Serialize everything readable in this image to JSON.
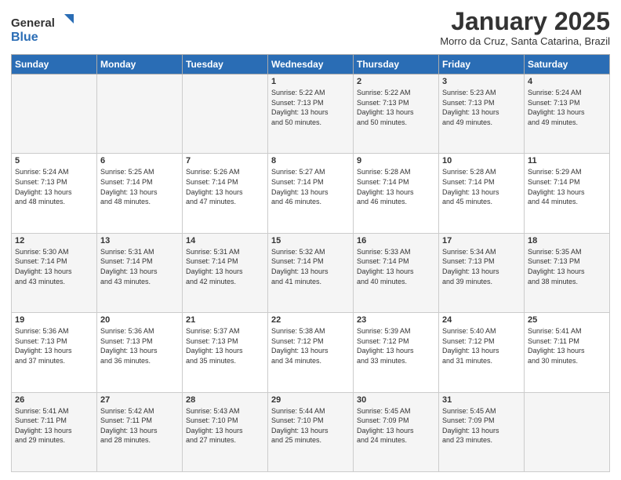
{
  "logo": {
    "line1": "General",
    "line2": "Blue"
  },
  "title": "January 2025",
  "location": "Morro da Cruz, Santa Catarina, Brazil",
  "days_header": [
    "Sunday",
    "Monday",
    "Tuesday",
    "Wednesday",
    "Thursday",
    "Friday",
    "Saturday"
  ],
  "weeks": [
    [
      {
        "day": "",
        "info": ""
      },
      {
        "day": "",
        "info": ""
      },
      {
        "day": "",
        "info": ""
      },
      {
        "day": "1",
        "info": "Sunrise: 5:22 AM\nSunset: 7:13 PM\nDaylight: 13 hours\nand 50 minutes."
      },
      {
        "day": "2",
        "info": "Sunrise: 5:22 AM\nSunset: 7:13 PM\nDaylight: 13 hours\nand 50 minutes."
      },
      {
        "day": "3",
        "info": "Sunrise: 5:23 AM\nSunset: 7:13 PM\nDaylight: 13 hours\nand 49 minutes."
      },
      {
        "day": "4",
        "info": "Sunrise: 5:24 AM\nSunset: 7:13 PM\nDaylight: 13 hours\nand 49 minutes."
      }
    ],
    [
      {
        "day": "5",
        "info": "Sunrise: 5:24 AM\nSunset: 7:13 PM\nDaylight: 13 hours\nand 48 minutes."
      },
      {
        "day": "6",
        "info": "Sunrise: 5:25 AM\nSunset: 7:14 PM\nDaylight: 13 hours\nand 48 minutes."
      },
      {
        "day": "7",
        "info": "Sunrise: 5:26 AM\nSunset: 7:14 PM\nDaylight: 13 hours\nand 47 minutes."
      },
      {
        "day": "8",
        "info": "Sunrise: 5:27 AM\nSunset: 7:14 PM\nDaylight: 13 hours\nand 46 minutes."
      },
      {
        "day": "9",
        "info": "Sunrise: 5:28 AM\nSunset: 7:14 PM\nDaylight: 13 hours\nand 46 minutes."
      },
      {
        "day": "10",
        "info": "Sunrise: 5:28 AM\nSunset: 7:14 PM\nDaylight: 13 hours\nand 45 minutes."
      },
      {
        "day": "11",
        "info": "Sunrise: 5:29 AM\nSunset: 7:14 PM\nDaylight: 13 hours\nand 44 minutes."
      }
    ],
    [
      {
        "day": "12",
        "info": "Sunrise: 5:30 AM\nSunset: 7:14 PM\nDaylight: 13 hours\nand 43 minutes."
      },
      {
        "day": "13",
        "info": "Sunrise: 5:31 AM\nSunset: 7:14 PM\nDaylight: 13 hours\nand 43 minutes."
      },
      {
        "day": "14",
        "info": "Sunrise: 5:31 AM\nSunset: 7:14 PM\nDaylight: 13 hours\nand 42 minutes."
      },
      {
        "day": "15",
        "info": "Sunrise: 5:32 AM\nSunset: 7:14 PM\nDaylight: 13 hours\nand 41 minutes."
      },
      {
        "day": "16",
        "info": "Sunrise: 5:33 AM\nSunset: 7:14 PM\nDaylight: 13 hours\nand 40 minutes."
      },
      {
        "day": "17",
        "info": "Sunrise: 5:34 AM\nSunset: 7:13 PM\nDaylight: 13 hours\nand 39 minutes."
      },
      {
        "day": "18",
        "info": "Sunrise: 5:35 AM\nSunset: 7:13 PM\nDaylight: 13 hours\nand 38 minutes."
      }
    ],
    [
      {
        "day": "19",
        "info": "Sunrise: 5:36 AM\nSunset: 7:13 PM\nDaylight: 13 hours\nand 37 minutes."
      },
      {
        "day": "20",
        "info": "Sunrise: 5:36 AM\nSunset: 7:13 PM\nDaylight: 13 hours\nand 36 minutes."
      },
      {
        "day": "21",
        "info": "Sunrise: 5:37 AM\nSunset: 7:13 PM\nDaylight: 13 hours\nand 35 minutes."
      },
      {
        "day": "22",
        "info": "Sunrise: 5:38 AM\nSunset: 7:12 PM\nDaylight: 13 hours\nand 34 minutes."
      },
      {
        "day": "23",
        "info": "Sunrise: 5:39 AM\nSunset: 7:12 PM\nDaylight: 13 hours\nand 33 minutes."
      },
      {
        "day": "24",
        "info": "Sunrise: 5:40 AM\nSunset: 7:12 PM\nDaylight: 13 hours\nand 31 minutes."
      },
      {
        "day": "25",
        "info": "Sunrise: 5:41 AM\nSunset: 7:11 PM\nDaylight: 13 hours\nand 30 minutes."
      }
    ],
    [
      {
        "day": "26",
        "info": "Sunrise: 5:41 AM\nSunset: 7:11 PM\nDaylight: 13 hours\nand 29 minutes."
      },
      {
        "day": "27",
        "info": "Sunrise: 5:42 AM\nSunset: 7:11 PM\nDaylight: 13 hours\nand 28 minutes."
      },
      {
        "day": "28",
        "info": "Sunrise: 5:43 AM\nSunset: 7:10 PM\nDaylight: 13 hours\nand 27 minutes."
      },
      {
        "day": "29",
        "info": "Sunrise: 5:44 AM\nSunset: 7:10 PM\nDaylight: 13 hours\nand 25 minutes."
      },
      {
        "day": "30",
        "info": "Sunrise: 5:45 AM\nSunset: 7:09 PM\nDaylight: 13 hours\nand 24 minutes."
      },
      {
        "day": "31",
        "info": "Sunrise: 5:45 AM\nSunset: 7:09 PM\nDaylight: 13 hours\nand 23 minutes."
      },
      {
        "day": "",
        "info": ""
      }
    ]
  ]
}
